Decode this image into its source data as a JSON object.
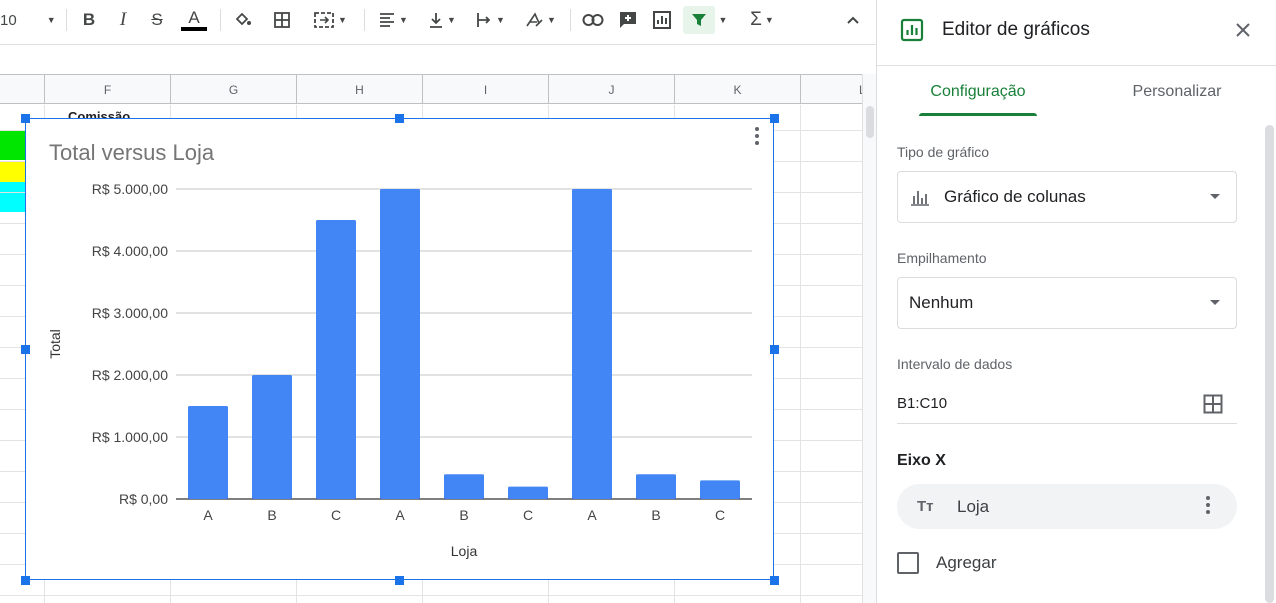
{
  "toolbar": {
    "font_size": "10",
    "bold": "B",
    "italic": "I",
    "strike": "S",
    "text_color_letter": "A",
    "function_symbol": "Σ"
  },
  "columns": [
    "F",
    "G",
    "H",
    "I",
    "J",
    "K",
    "L"
  ],
  "cell_text": "Comissão",
  "row_colors": [
    "#00e600",
    "#ffff00",
    "#00ffff"
  ],
  "chart": {
    "title": "Total versus Loja",
    "ylabel": "Total",
    "xlabel": "Loja",
    "bar_color": "#4285f4"
  },
  "chart_data": {
    "type": "bar",
    "title": "Total versus Loja",
    "xlabel": "Loja",
    "ylabel": "Total",
    "categories": [
      "A",
      "B",
      "C",
      "A",
      "B",
      "C",
      "A",
      "B",
      "C"
    ],
    "values": [
      1500,
      2000,
      4500,
      5000,
      400,
      200,
      5000,
      400,
      300
    ],
    "ylim": [
      0,
      5000
    ],
    "yticks": [
      "R$ 0,00",
      "R$ 1.000,00",
      "R$ 2.000,00",
      "R$ 3.000,00",
      "R$ 4.000,00",
      "R$ 5.000,00"
    ],
    "ytick_values": [
      0,
      1000,
      2000,
      3000,
      4000,
      5000
    ],
    "grid": true,
    "legend": "none"
  },
  "panel": {
    "title": "Editor de gráficos",
    "tabs": [
      {
        "label": "Configuração",
        "active": true
      },
      {
        "label": "Personalizar",
        "active": false
      }
    ],
    "chart_type_label": "Tipo de gráfico",
    "chart_type_value": "Gráfico de colunas",
    "stacking_label": "Empilhamento",
    "stacking_value": "Nenhum",
    "range_label": "Intervalo de dados",
    "range_value": "B1:C10",
    "x_axis_title": "Eixo X",
    "x_axis_chip": "Loja",
    "aggregate_label": "Agregar",
    "accent_color": "#188038"
  },
  "icons": {
    "close": "close-icon",
    "chart": "chart-icon",
    "grid": "grid-select-icon"
  }
}
